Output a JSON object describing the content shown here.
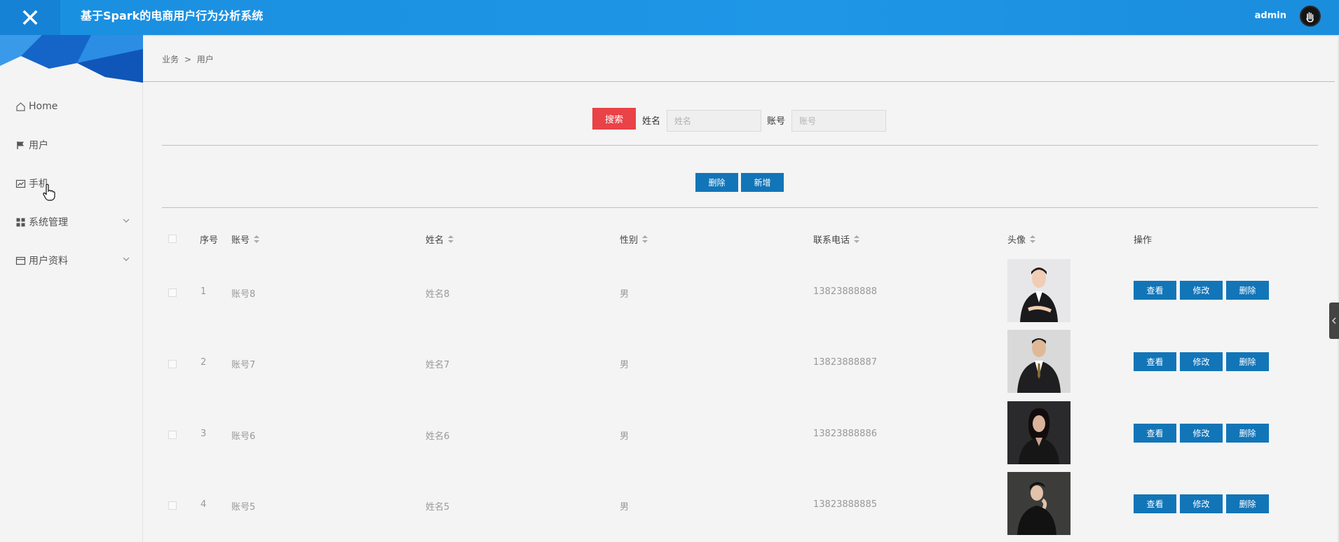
{
  "header": {
    "title": "基于Spark的电商用户行为分析系统",
    "user": "admin"
  },
  "sidebar": {
    "items": [
      {
        "label": "Home",
        "icon": "home-icon"
      },
      {
        "label": "用户",
        "icon": "flag-icon"
      },
      {
        "label": "手机",
        "icon": "chart-icon"
      },
      {
        "label": "系统管理",
        "icon": "grid-icon",
        "expandable": true
      },
      {
        "label": "用户资料",
        "icon": "card-icon",
        "expandable": true
      }
    ]
  },
  "breadcrumb": {
    "parent": "业务",
    "separator": ">",
    "current": "用户"
  },
  "search": {
    "button": "搜索",
    "name_label": "姓名",
    "name_placeholder": "姓名",
    "account_label": "账号",
    "account_placeholder": "账号"
  },
  "toolbar": {
    "delete": "删除",
    "add": "新增"
  },
  "table": {
    "headers": {
      "index": "序号",
      "account": "账号",
      "name": "姓名",
      "gender": "性别",
      "phone": "联系电话",
      "avatar": "头像",
      "actions": "操作"
    },
    "rows": [
      {
        "index": "1",
        "account": "账号8",
        "name": "姓名8",
        "gender": "男",
        "phone": "13823888888"
      },
      {
        "index": "2",
        "account": "账号7",
        "name": "姓名7",
        "gender": "男",
        "phone": "13823888887"
      },
      {
        "index": "3",
        "account": "账号6",
        "name": "姓名6",
        "gender": "男",
        "phone": "13823888886"
      },
      {
        "index": "4",
        "account": "账号5",
        "name": "姓名5",
        "gender": "男",
        "phone": "13823888885"
      }
    ],
    "row_actions": {
      "view": "查看",
      "edit": "修改",
      "delete": "删除"
    }
  },
  "colors": {
    "header": "#1f96e6",
    "search_button": "#e94247",
    "action_button": "#1275b8"
  }
}
